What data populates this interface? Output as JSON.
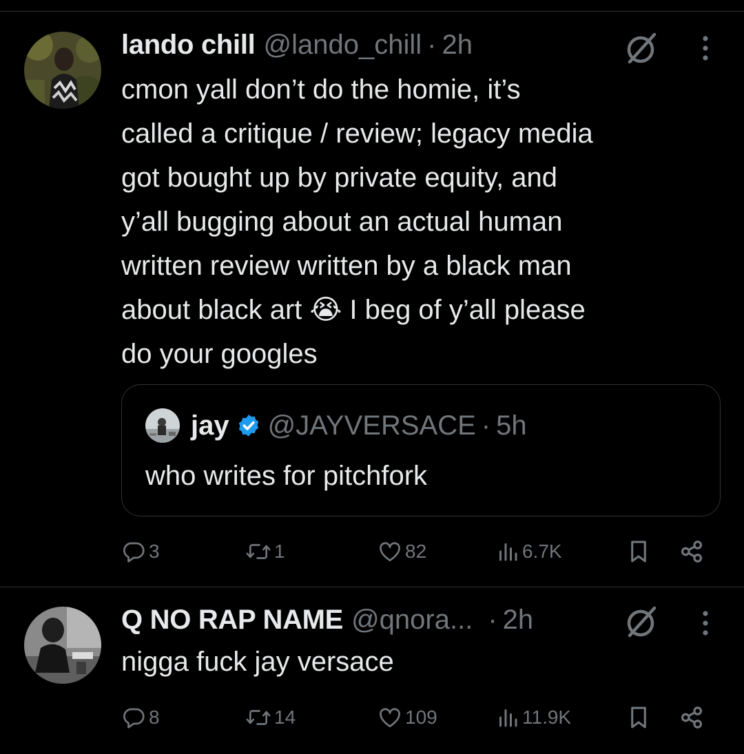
{
  "tweets": [
    {
      "name": "lando chill",
      "handle": "@lando_chill",
      "dot": "·",
      "time": "2h",
      "text": "cmon yall don’t do the homie, it’s\ncalled a critique / review; legacy media\ngot bought up by private equity, and\ny’all bugging about an actual human\nwritten review written by a black man\nabout black art 😭 I beg of y’all please\ndo your googles",
      "quote": {
        "name": "jay",
        "handle": "@JAYVERSACE",
        "dot": "·",
        "time": "5h",
        "text": "who writes for pitchfork"
      },
      "replies": "3",
      "reposts": "1",
      "likes": "82",
      "views": "6.7K"
    },
    {
      "name": "Q NO RAP NAME",
      "handle": "@qnora...",
      "dot": "·",
      "time": "2h",
      "text": "nigga fuck jay versace",
      "replies": "8",
      "reposts": "14",
      "likes": "109",
      "views": "11.9K"
    }
  ],
  "icons": {
    "grok": "slashed-circle-icon",
    "more": "more-vertical-icon",
    "verified": "verified-badge-icon",
    "reply": "reply-icon",
    "repost": "repost-icon",
    "like": "heart-icon",
    "views": "views-icon",
    "bookmark": "bookmark-icon",
    "share": "share-icon"
  },
  "colors": {
    "background": "#000000",
    "text": "#e7e9ea",
    "secondary": "#71767b",
    "border": "#2f3336",
    "verified": "#1d9bf0"
  }
}
